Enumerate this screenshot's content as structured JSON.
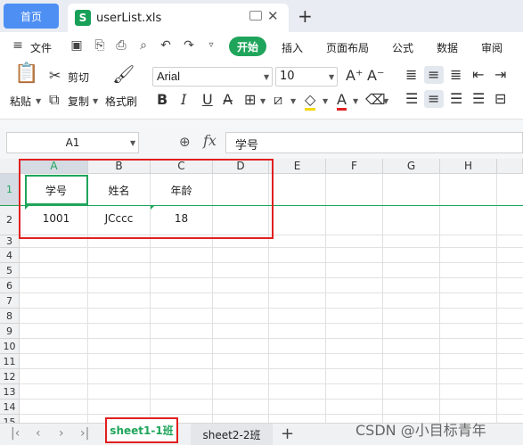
{
  "tabs": {
    "home": "首页",
    "file_name": "userList.xls",
    "file_icon_letter": "S"
  },
  "menu": {
    "file": "文件",
    "items": [
      "开始",
      "插入",
      "页面布局",
      "公式",
      "数据",
      "审阅"
    ]
  },
  "ribbon": {
    "paste": "粘贴",
    "cut": "剪切",
    "copy": "复制",
    "format_painter": "格式刷",
    "font": "Arial",
    "font_size": "10",
    "bold": "B",
    "italic": "I",
    "underline": "U"
  },
  "formula_bar": {
    "cell_ref": "A1",
    "fx": "fx",
    "content": "学号"
  },
  "sheet": {
    "columns": [
      "A",
      "B",
      "C",
      "D",
      "E",
      "F",
      "G",
      "H"
    ],
    "rows": [
      "1",
      "2",
      "3",
      "4",
      "5",
      "6",
      "7",
      "8",
      "9",
      "10",
      "11",
      "12",
      "13",
      "14",
      "15"
    ],
    "cells": {
      "A1": "学号",
      "B1": "姓名",
      "C1": "年龄",
      "A2": "1001",
      "B2": "JCccc",
      "C2": "18"
    }
  },
  "sheet_tabs": {
    "active": "sheet1-1班",
    "other": "sheet2-2班"
  },
  "watermark": "CSDN @小目标青年",
  "colors": {
    "accent": "#1fa55b",
    "home_tab": "#4e8ff4",
    "highlight_box": "#e02020"
  }
}
